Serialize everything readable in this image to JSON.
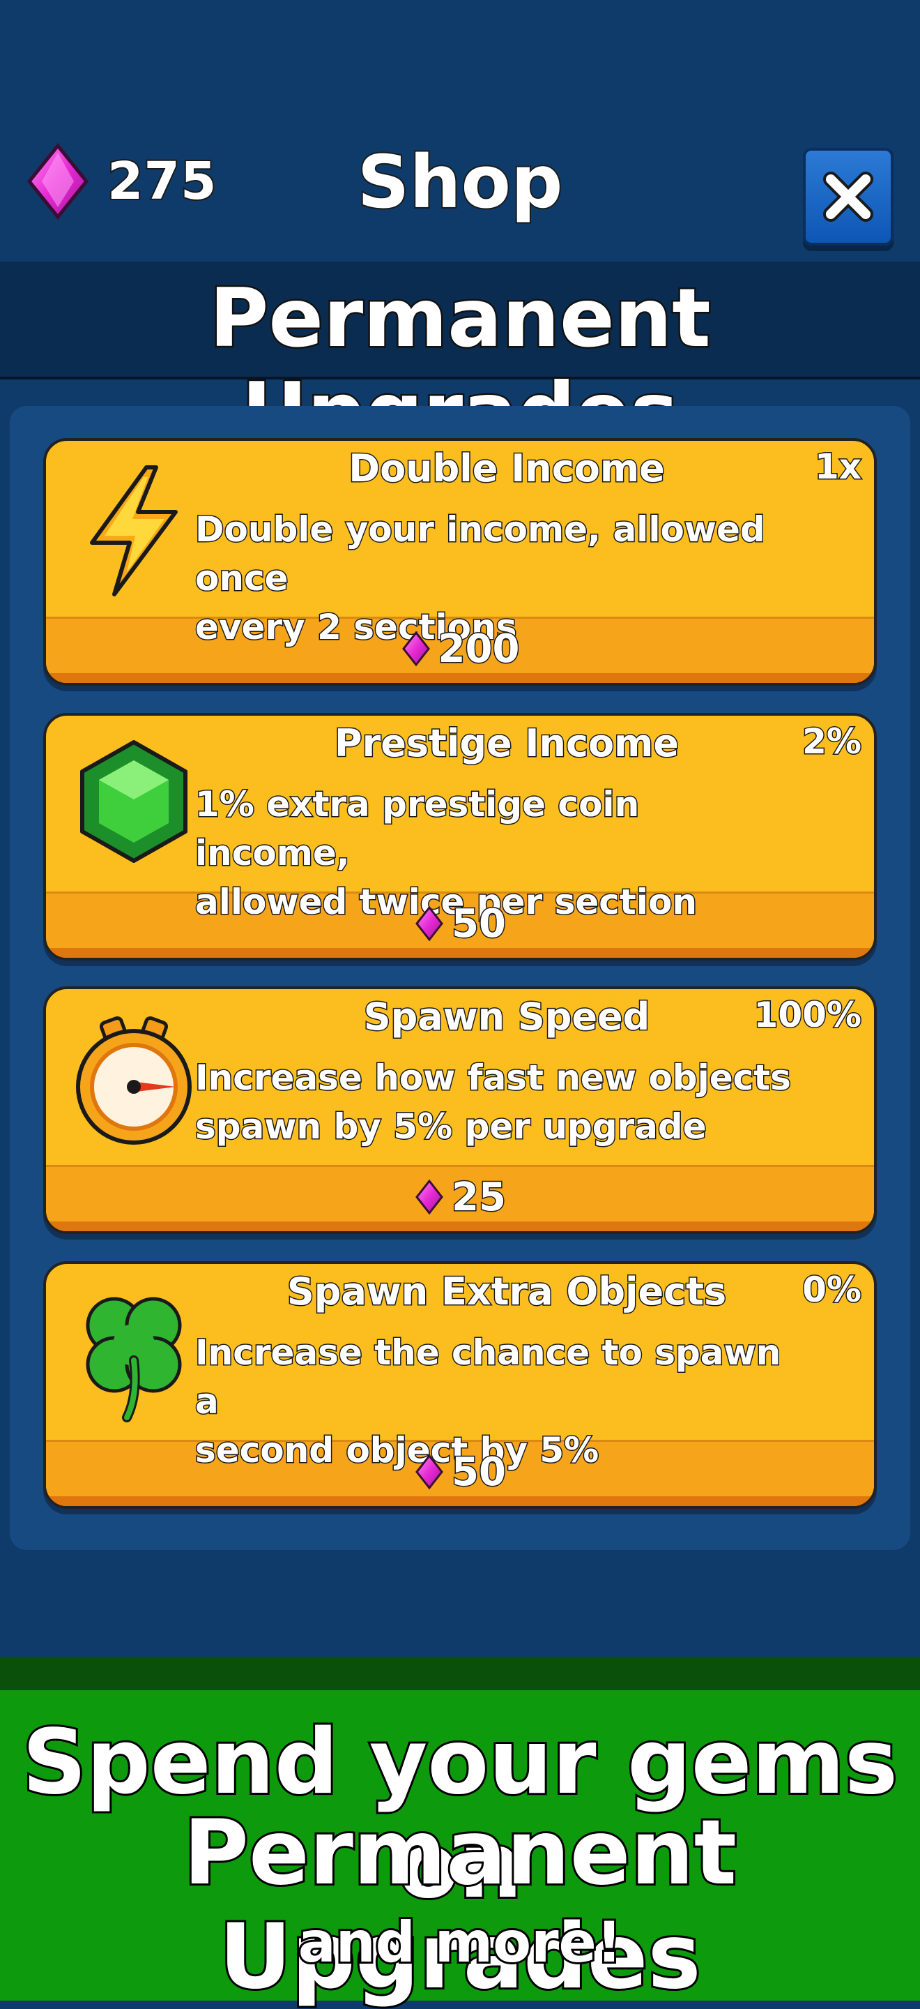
{
  "header": {
    "gem_count": "275",
    "title": "Shop",
    "close_icon": "close-icon"
  },
  "banner": {
    "title": "Permanent Upgrades"
  },
  "upgrades": [
    {
      "name": "Double Income",
      "level": "1x",
      "desc1": "Double your income, allowed once",
      "desc2": "every 2 sections",
      "price": "200",
      "icon": "lightning-icon"
    },
    {
      "name": "Prestige Income",
      "level": "2%",
      "desc1": "1% extra prestige coin income,",
      "desc2": "allowed twice per section",
      "price": "50",
      "icon": "emerald-gem-icon"
    },
    {
      "name": "Spawn Speed",
      "level": "100%",
      "desc1": "Increase how fast new objects",
      "desc2": "spawn by 5% per upgrade",
      "price": "25",
      "icon": "stopwatch-icon"
    },
    {
      "name": "Spawn Extra Objects",
      "level": "0%",
      "desc1": "Increase the chance to spawn a",
      "desc2": "second object by 5%",
      "price": "50",
      "icon": "four-leaf-clover-icon"
    }
  ],
  "promo": {
    "line1": "Spend your gems on",
    "line2": "Permanent Upgrades",
    "line3": "and more!"
  },
  "colors": {
    "background": "#0f3b6a",
    "card": "#fcbe1e",
    "gem": "#e82bd6",
    "promo_green": "#0d9a0d"
  }
}
